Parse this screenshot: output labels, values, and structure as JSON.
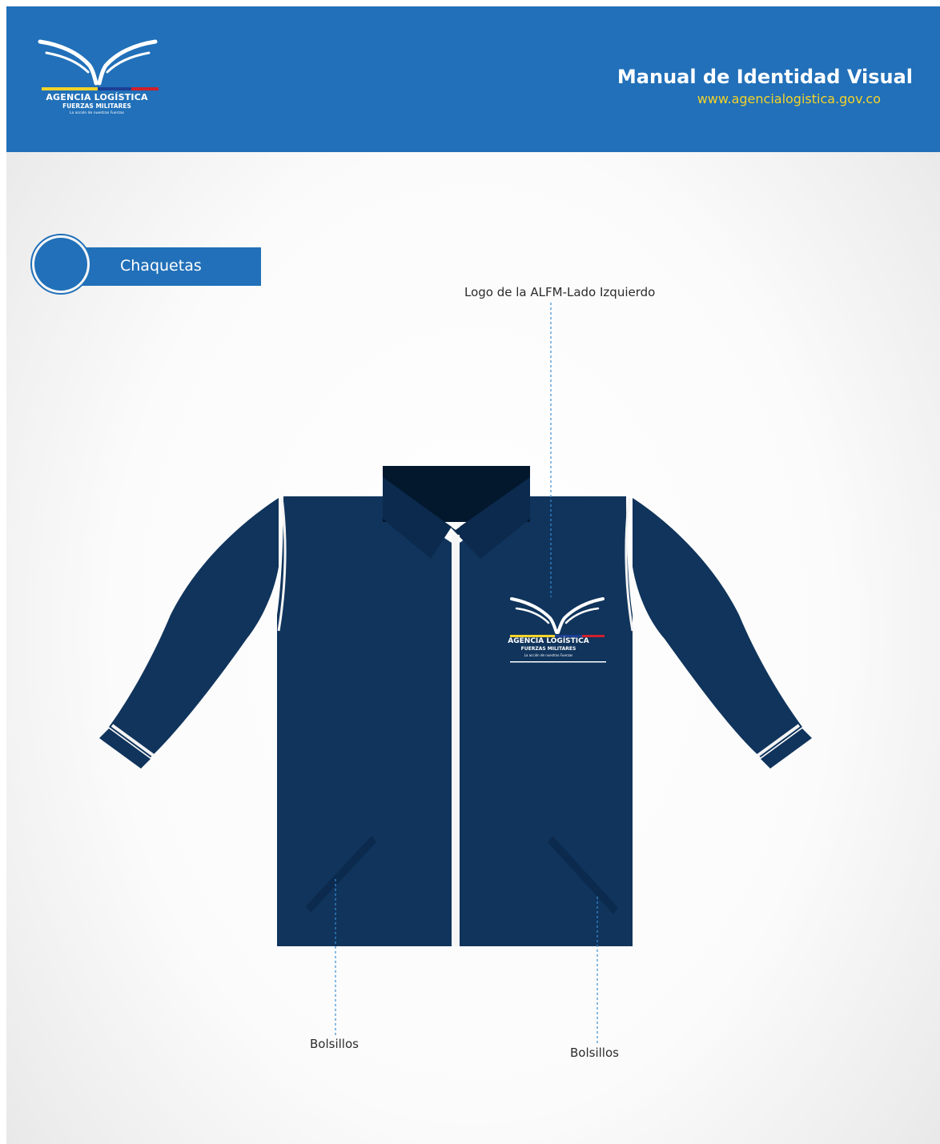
{
  "header": {
    "logo": {
      "name": "AGENCIA LOGÍSTICA",
      "subtitle": "FUERZAS MILITARES",
      "tagline": "La acción de nuestras Fuerzas"
    },
    "title": "Manual de Identidad Visual",
    "url": "www.agencialogistica.gov.co"
  },
  "section": {
    "label": "Chaquetas"
  },
  "annotations": {
    "logo_placement": "Logo de la ALFM-Lado Izquierdo",
    "pocket_left": "Bolsillos",
    "pocket_right": "Bolsillos"
  },
  "colors": {
    "header_blue": "#2170b9",
    "url_yellow": "#f5d328",
    "jacket_navy": "#10345c",
    "collar_dark": "#03172d",
    "flag_yellow": "#f5d328",
    "flag_blue": "#1c3f94",
    "flag_red": "#d0202c"
  }
}
